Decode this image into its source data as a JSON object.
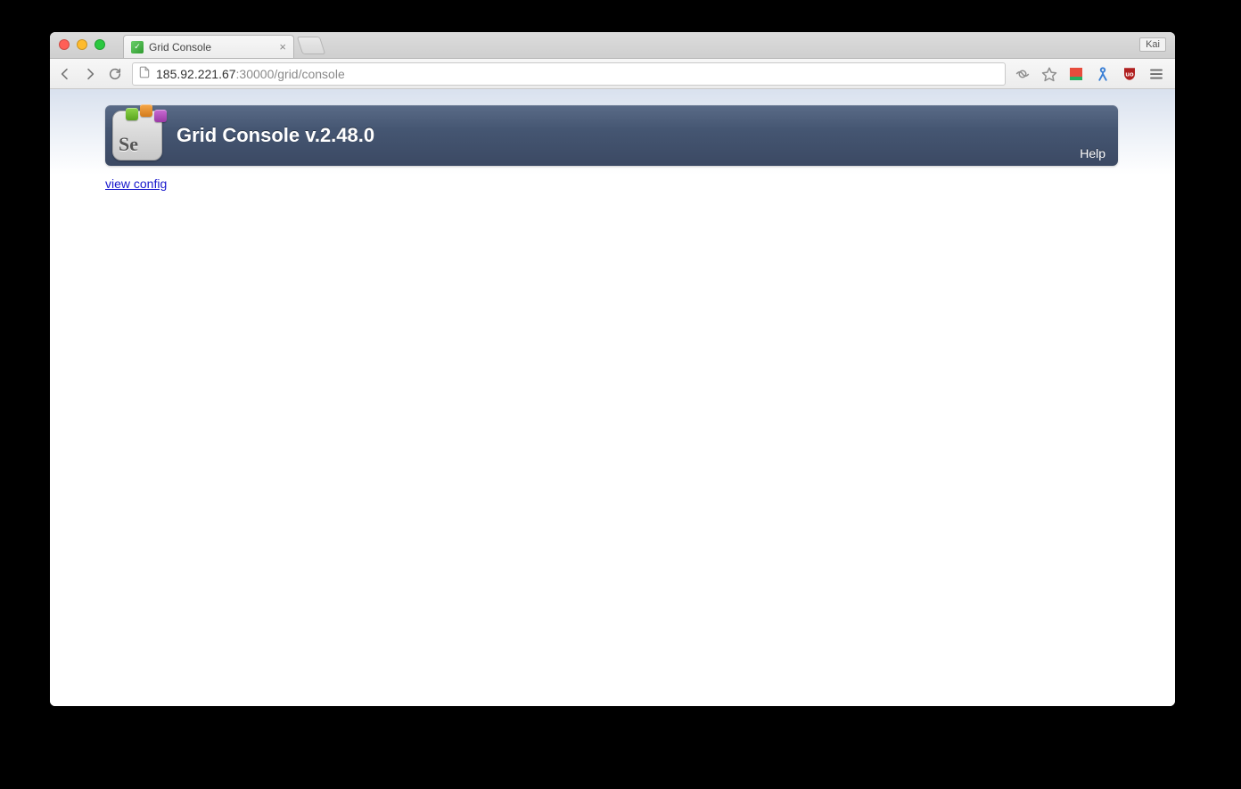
{
  "browser": {
    "tab_title": "Grid Console",
    "profile_name": "Kai",
    "url_host": "185.92.221.67",
    "url_port_path": ":30000/grid/console"
  },
  "page": {
    "logo_text": "Se",
    "header_title": "Grid Console v.2.48.0",
    "help_label": "Help",
    "view_config_label": "view config"
  }
}
